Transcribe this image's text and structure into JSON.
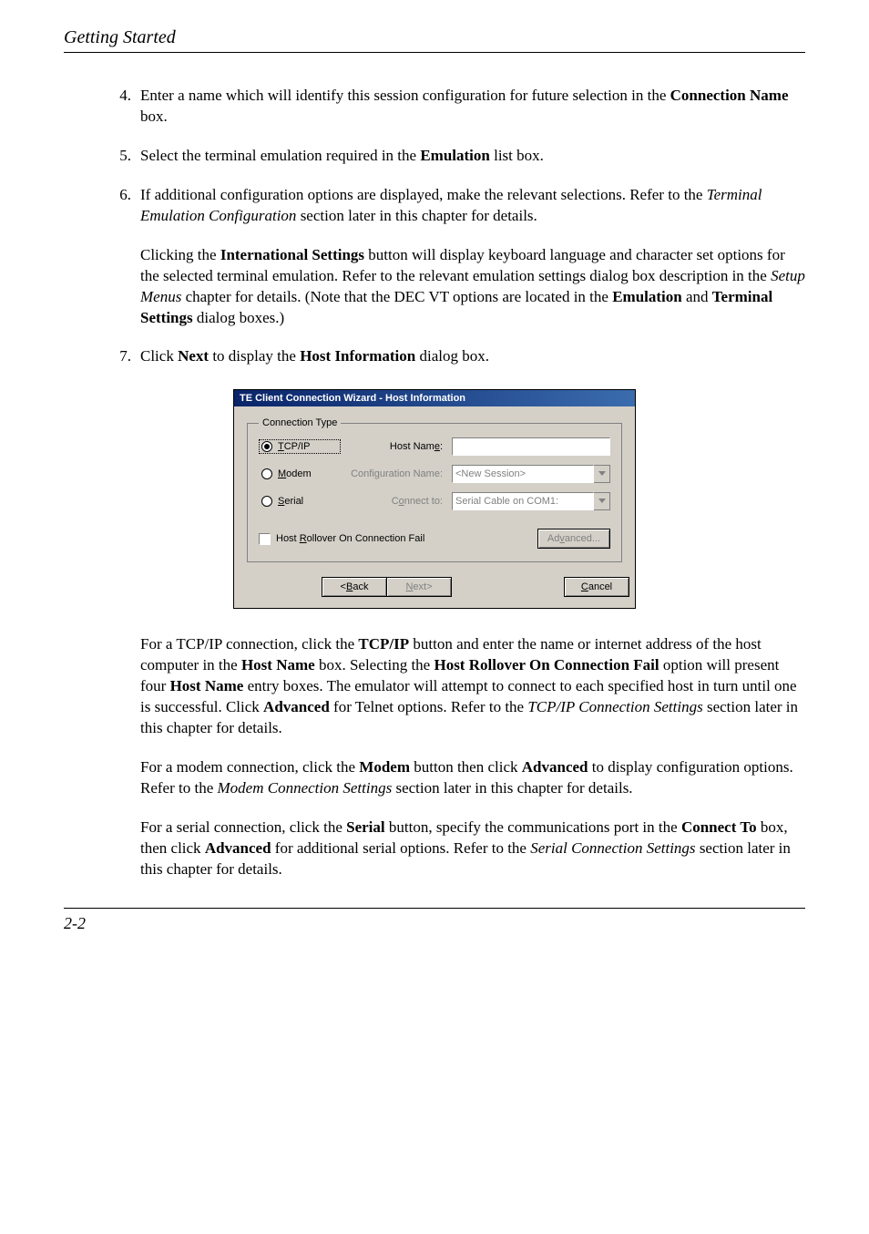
{
  "header": {
    "chapter_title": "Getting Started"
  },
  "steps": {
    "s4": {
      "num": "4.",
      "t1": "Enter a name which will identify this session configuration for future selection in the ",
      "b1": "Connection Name",
      "t2": " box."
    },
    "s5": {
      "num": "5.",
      "t1": "Select the terminal emulation required in the ",
      "b1": "Emulation",
      "t2": " list box."
    },
    "s6": {
      "num": "6.",
      "t1": "If additional configuration options are displayed, make the relevant selections. Refer to the ",
      "i1": "Terminal Emulation Configuration",
      "t2": " section later in this chapter for details."
    },
    "s6b": {
      "t1": "Clicking the ",
      "b1": "International Settings",
      "t2": " button will display keyboard language and character set options for the selected terminal emulation. Refer to the relevant emulation settings dialog box description in the ",
      "i1": "Setup Menus",
      "t3": " chapter for details. (Note that the DEC VT options are located in the ",
      "b2": "Emulation",
      "t4": " and ",
      "b3": "Terminal Settings",
      "t5": " dialog boxes.)"
    },
    "s7": {
      "num": "7.",
      "t1": "Click ",
      "b1": "Next",
      "t2": " to display the ",
      "b2": "Host Information",
      "t3": " dialog box."
    }
  },
  "dialog": {
    "title": "TE Client Connection Wizard - Host Information",
    "legend": "Connection Type",
    "radio_tcpip": "TCP/IP",
    "radio_modem": "Modem",
    "radio_serial": "Serial",
    "lbl_hostname": "Host Name:",
    "lbl_confname": "Configuration Name:",
    "lbl_connectto": "Connect to:",
    "val_hostname": "",
    "val_confname": "<New Session>",
    "val_connectto": "Serial Cable on COM1:",
    "chk_rollover": "Host Rollover On Connection Fail",
    "btn_advanced": "Advanced...",
    "btn_back": "<Back",
    "btn_next": "Next>",
    "btn_cancel": "Cancel"
  },
  "para_tcpip": {
    "t1": "For a TCP/IP connection, click the ",
    "b1": "TCP/IP",
    "t2": " button and enter the name or internet address of the host computer in the ",
    "b2": "Host Name",
    "t3": " box. Selecting the ",
    "b3": "Host Rollover On Connection Fail",
    "t4": " option will present four ",
    "b4": "Host Name",
    "t5": " entry boxes. The emulator will attempt to connect to each specified host in turn until one is successful. Click ",
    "b5": "Advanced",
    "t6": " for Telnet options. Refer to the ",
    "i1": "TCP/IP Connection Settings",
    "t7": " section later in this chapter for details."
  },
  "para_modem": {
    "t1": "For a modem connection, click the ",
    "b1": "Modem",
    "t2": " button then click ",
    "b2": "Advanced",
    "t3": " to display configuration options. Refer to the ",
    "i1": "Modem Connection Settings",
    "t4": " section later in this chapter for details."
  },
  "para_serial": {
    "t1": "For a serial connection, click the ",
    "b1": "Serial",
    "t2": " button, specify the communications port in the ",
    "b2": "Connect To",
    "t3": " box, then click ",
    "b3": "Advanced",
    "t4": " for additional serial options. Refer to the ",
    "i1": "Serial Connection Settings",
    "t5": " section later in this chapter for details."
  },
  "footer": {
    "page_num": "2-2"
  }
}
